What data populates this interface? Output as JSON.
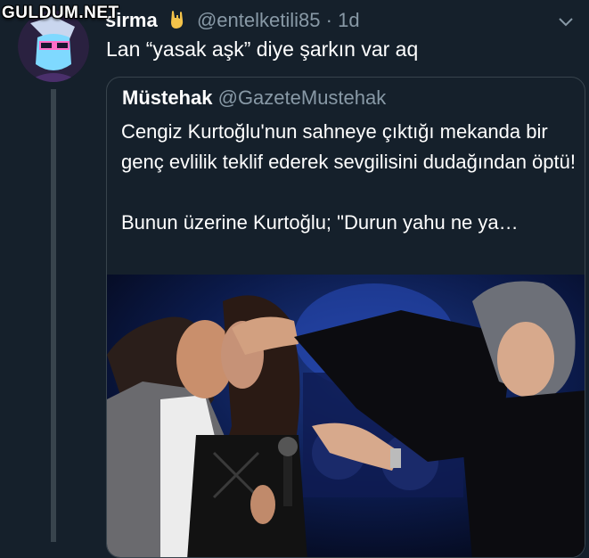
{
  "watermark": "GULDUM.NET",
  "tweet": {
    "name": "sirma",
    "handle": "@entelketili85",
    "separator": "·",
    "time": "1d",
    "text": "Lan “yasak aşk” diye şarkın var aq",
    "emoji": "rock-hand-emoji"
  },
  "quote": {
    "name": "Müstehak",
    "handle": "@GazeteMustehak",
    "text_line1": "Cengiz Kurtoğlu'nun sahneye çıktığı mekanda bir genç evlilik teklif ederek sevgilisini dudağından öptü!",
    "text_line2": "Bunun üzerine Kurtoğlu; \"Durun yahu ne ya…"
  },
  "colors": {
    "background": "#15202b",
    "border": "#38444d",
    "secondary_text": "#8899a6"
  }
}
